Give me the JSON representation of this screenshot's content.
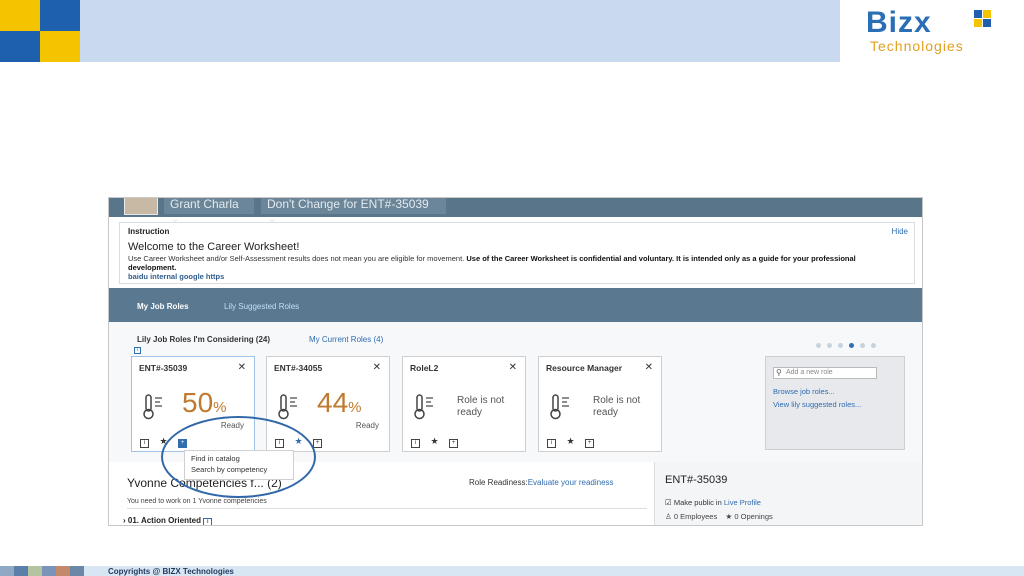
{
  "slide": {
    "logo": {
      "name": "Bizx",
      "sub": "Technologies"
    },
    "copyright": "Copyrights @ BIZX Technologies"
  },
  "header": {
    "user_name": "Grant Charla",
    "plan_select": "Don't Change for ENT#-35039"
  },
  "instruction": {
    "title": "Instruction",
    "hide": "Hide",
    "welcome": "Welcome to the Career Worksheet!",
    "body_plain": "Use Career Worksheet and/or Self-Assessment results does not mean you are eligible for movement.",
    "body_bold": "Use of the Career Worksheet is confidential and voluntary. It is intended only as a guide for your professional development.",
    "links": "baidu internal google https"
  },
  "tabs": [
    {
      "label": "My Job Roles",
      "active": true
    },
    {
      "label": "Lily Suggested Roles",
      "active": false
    }
  ],
  "roles": {
    "heading": "Lily Job Roles I'm Considering (24)",
    "current_link": "My Current Roles (4)",
    "cards": [
      {
        "title": "ENT#-35039",
        "percent": "50",
        "pct_sign": "%",
        "status": "Ready",
        "selected": true
      },
      {
        "title": "ENT#-34055",
        "percent": "44",
        "pct_sign": "%",
        "status": "Ready",
        "selected": false
      },
      {
        "title": "RoleL2",
        "status": "Role is not ready"
      },
      {
        "title": "Resource Manager",
        "status": "Role is not ready"
      }
    ],
    "add": {
      "placeholder": "Add a new role",
      "browse": "Browse job roles...",
      "view": "View lily suggested roles..."
    }
  },
  "popup": {
    "find": "Find in catalog",
    "search": "Search by competency"
  },
  "competencies": {
    "title": "Yvonne Competencies f... (2)",
    "readiness_label": "Role Readiness:",
    "readiness_link": "Evaluate your readiness",
    "subtitle": "You need to work on 1 Yvonne competencies",
    "item": "01. Action Oriented"
  },
  "detail": {
    "title": "ENT#-35039",
    "public_label": "Make public in",
    "public_link": "Live Profile",
    "employees_count": "0",
    "employees_label": "Employees",
    "openings_count": "0",
    "openings_label": "Openings"
  },
  "colors": {
    "accent": "#2f6cb0",
    "header": "#59758a",
    "percent": "#c07a30",
    "highlight_oval": "#3168a8"
  }
}
